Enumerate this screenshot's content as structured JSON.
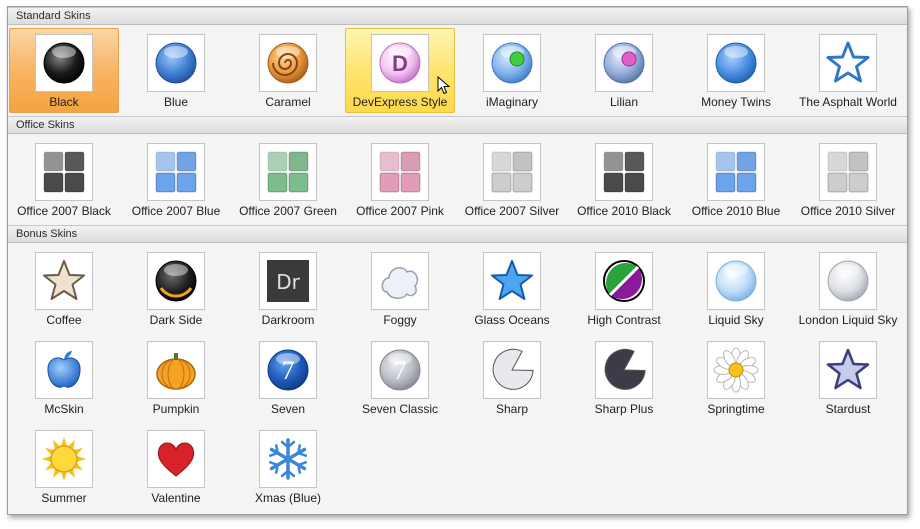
{
  "groups": [
    {
      "title": "Standard Skins",
      "items": [
        {
          "label": "Black",
          "icon": "black-orb-icon",
          "state": "selected"
        },
        {
          "label": "Blue",
          "icon": "blue-orb-icon"
        },
        {
          "label": "Caramel",
          "icon": "caramel-swirl-icon"
        },
        {
          "label": "DevExpress Style",
          "icon": "devexpress-logo-icon",
          "state": "hovered"
        },
        {
          "label": "iMaginary",
          "icon": "imaginary-orb-icon"
        },
        {
          "label": "Lilian",
          "icon": "lilian-orb-icon"
        },
        {
          "label": "Money Twins",
          "icon": "money-twins-orb-icon"
        },
        {
          "label": "The Asphalt World",
          "icon": "outline-star-icon"
        }
      ]
    },
    {
      "title": "Office Skins",
      "items": [
        {
          "label": "Office 2007 Black",
          "icon": "office-squares-black-icon"
        },
        {
          "label": "Office 2007 Blue",
          "icon": "office-squares-blue-icon"
        },
        {
          "label": "Office 2007 Green",
          "icon": "office-squares-green-icon"
        },
        {
          "label": "Office 2007 Pink",
          "icon": "office-squares-pink-icon"
        },
        {
          "label": "Office 2007 Silver",
          "icon": "office-squares-silver-icon"
        },
        {
          "label": "Office 2010 Black",
          "icon": "office-squares-black-icon"
        },
        {
          "label": "Office 2010 Blue",
          "icon": "office-squares-blue-icon"
        },
        {
          "label": "Office 2010 Silver",
          "icon": "office-squares-silver-icon"
        }
      ]
    },
    {
      "title": "Bonus Skins",
      "items": [
        {
          "label": "Coffee",
          "icon": "coffee-star-icon"
        },
        {
          "label": "Dark Side",
          "icon": "dark-side-orb-icon"
        },
        {
          "label": "Darkroom",
          "icon": "darkroom-dr-icon",
          "glyph": "Dr"
        },
        {
          "label": "Foggy",
          "icon": "foggy-cloud-icon"
        },
        {
          "label": "Glass Oceans",
          "icon": "glass-oceans-star-icon"
        },
        {
          "label": "High Contrast",
          "icon": "high-contrast-circle-icon"
        },
        {
          "label": "Liquid Sky",
          "icon": "liquid-sky-orb-icon"
        },
        {
          "label": "London Liquid Sky",
          "icon": "london-liquid-sky-orb-icon"
        },
        {
          "label": "McSkin",
          "icon": "apple-icon"
        },
        {
          "label": "Pumpkin",
          "icon": "pumpkin-icon"
        },
        {
          "label": "Seven",
          "icon": "seven-orb-icon",
          "glyph": "7"
        },
        {
          "label": "Seven Classic",
          "icon": "seven-classic-orb-icon",
          "glyph": "7"
        },
        {
          "label": "Sharp",
          "icon": "sharp-pacman-icon"
        },
        {
          "label": "Sharp Plus",
          "icon": "sharp-plus-pacman-icon"
        },
        {
          "label": "Springtime",
          "icon": "daisy-flower-icon"
        },
        {
          "label": "Stardust",
          "icon": "stardust-star-icon"
        },
        {
          "label": "Summer",
          "icon": "sun-icon"
        },
        {
          "label": "Valentine",
          "icon": "heart-icon"
        },
        {
          "label": "Xmas (Blue)",
          "icon": "snowflake-icon"
        }
      ]
    }
  ]
}
